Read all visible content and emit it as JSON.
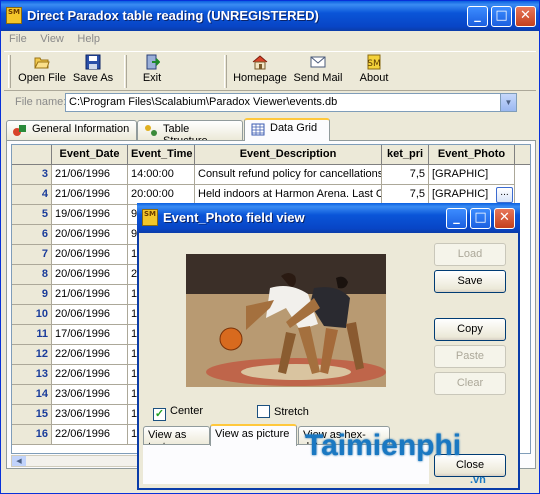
{
  "main": {
    "title": "Direct Paradox table reading (UNREGISTERED)",
    "app_icon_text": "SM",
    "controls": {
      "minimize": "_",
      "maximize": "□",
      "close": "✕"
    }
  },
  "menu": [
    "File",
    "View",
    "Help"
  ],
  "toolbar": {
    "open_file": "Open File",
    "save_as": "Save As",
    "exit": "Exit",
    "homepage": "Homepage",
    "send_mail": "Send Mail",
    "about": "About"
  },
  "filebar": {
    "label": "File name:",
    "value": "C:\\Program Files\\Scalabium\\Paradox Viewer\\events.db"
  },
  "tabs": [
    "General Information",
    "Table Structure",
    "Data Grid"
  ],
  "active_tab": "Data Grid",
  "grid": {
    "columns": [
      "Event_Date",
      "Event_Time",
      "Event_Description",
      "ket_pri",
      "Event_Photo"
    ],
    "rows": [
      {
        "n": "3",
        "date": "21/06/1996",
        "time": "14:00:00",
        "desc": "Consult refund policy for cancellations",
        "price": "7,5",
        "photo": "[GRAPHIC]"
      },
      {
        "n": "4",
        "date": "21/06/1996",
        "time": "20:00:00",
        "desc": "Held indoors at Harmon Arena.  Last C",
        "price": "7,5",
        "photo": "[GRAPHIC]"
      },
      {
        "n": "5",
        "date": "19/06/1996",
        "time": "9:",
        "desc": "",
        "price": "",
        "photo": ""
      },
      {
        "n": "6",
        "date": "20/06/1996",
        "time": "9:",
        "desc": "",
        "price": "",
        "photo": ""
      },
      {
        "n": "7",
        "date": "20/06/1996",
        "time": "1",
        "desc": "",
        "price": "",
        "photo": ""
      },
      {
        "n": "8",
        "date": "20/06/1996",
        "time": "2",
        "desc": "",
        "price": "",
        "photo": ""
      },
      {
        "n": "9",
        "date": "21/06/1996",
        "time": "1",
        "desc": "",
        "price": "",
        "photo": ""
      },
      {
        "n": "10",
        "date": "20/06/1996",
        "time": "1",
        "desc": "",
        "price": "",
        "photo": ""
      },
      {
        "n": "11",
        "date": "17/06/1996",
        "time": "1",
        "desc": "",
        "price": "",
        "photo": ""
      },
      {
        "n": "12",
        "date": "22/06/1996",
        "time": "1",
        "desc": "",
        "price": "",
        "photo": ""
      },
      {
        "n": "13",
        "date": "22/06/1996",
        "time": "1",
        "desc": "",
        "price": "",
        "photo": ""
      },
      {
        "n": "14",
        "date": "23/06/1996",
        "time": "1",
        "desc": "",
        "price": "",
        "photo": ""
      },
      {
        "n": "15",
        "date": "23/06/1996",
        "time": "1",
        "desc": "",
        "price": "",
        "photo": ""
      },
      {
        "n": "16",
        "date": "22/06/1996",
        "time": "1",
        "desc": "",
        "price": "",
        "photo": ""
      }
    ]
  },
  "dialog": {
    "title": "Event_Photo field view",
    "icon_text": "SM",
    "buttons": {
      "load": "Load",
      "save": "Save",
      "copy": "Copy",
      "paste": "Paste",
      "clear": "Clear",
      "close": "Close"
    },
    "center_label": "Center",
    "stretch_label": "Stretch",
    "view_tabs": [
      "View as text",
      "View as picture",
      "View as hex-data"
    ],
    "active_view": "View as picture"
  },
  "watermark": {
    "text": "Taimienphi",
    "sub": ".vn"
  },
  "colors": {
    "title_blue": "#0a55d8",
    "tab_highlight": "#ffc83c",
    "row_number": "#1a3c9a"
  }
}
